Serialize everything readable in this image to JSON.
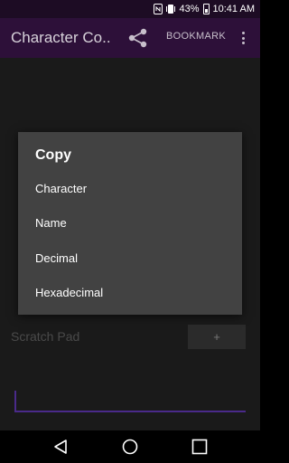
{
  "status_bar": {
    "battery_percent": "43%",
    "time": "10:41 AM"
  },
  "app_bar": {
    "title": "Character Co...",
    "share_icon": "share-icon",
    "bookmark_label": "BOOKMARK",
    "overflow_icon": "more-vert-icon"
  },
  "scratch_pad": {
    "label": "Scratch Pad",
    "add_label": "+",
    "input_value": ""
  },
  "dialog": {
    "title": "Copy",
    "items": [
      {
        "label": "Character"
      },
      {
        "label": "Name"
      },
      {
        "label": "Decimal"
      },
      {
        "label": "Hexadecimal"
      }
    ]
  },
  "nav_bar": {
    "back_icon": "back-icon",
    "home_icon": "home-icon",
    "recents_icon": "recents-icon"
  },
  "colors": {
    "status_bar": "#1d0c24",
    "app_bar": "#2d1039",
    "dialog": "#424242",
    "input_underline": "#4a2a8a"
  }
}
